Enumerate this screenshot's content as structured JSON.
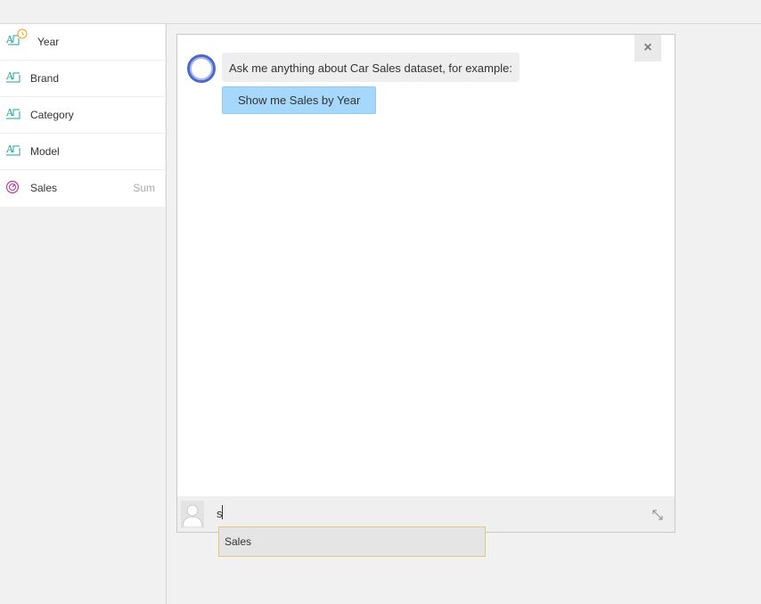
{
  "fields": [
    {
      "label": "Year",
      "icon": "text-date-field-icon",
      "aggregation": ""
    },
    {
      "label": "Brand",
      "icon": "text-field-icon",
      "aggregation": ""
    },
    {
      "label": "Category",
      "icon": "text-field-icon",
      "aggregation": ""
    },
    {
      "label": "Model",
      "icon": "text-field-icon",
      "aggregation": ""
    },
    {
      "label": "Sales",
      "icon": "measure-gauge-icon",
      "aggregation": "Sum"
    }
  ],
  "chat": {
    "close_label": "×",
    "bot_message": "Ask me anything about Car Sales dataset, for example:",
    "suggestion": "Show me Sales by Year",
    "input_value": "s",
    "input_placeholder": ""
  },
  "autocomplete": {
    "items": [
      "Sales"
    ]
  },
  "colors": {
    "accent_teal": "#1aa39a",
    "measure_magenta": "#c0379a",
    "date_orange": "#f0a21d",
    "bot_blue": "#4a69c8",
    "suggestion_bg": "#a6d8fb",
    "autocomplete_border": "#e3c77f"
  }
}
